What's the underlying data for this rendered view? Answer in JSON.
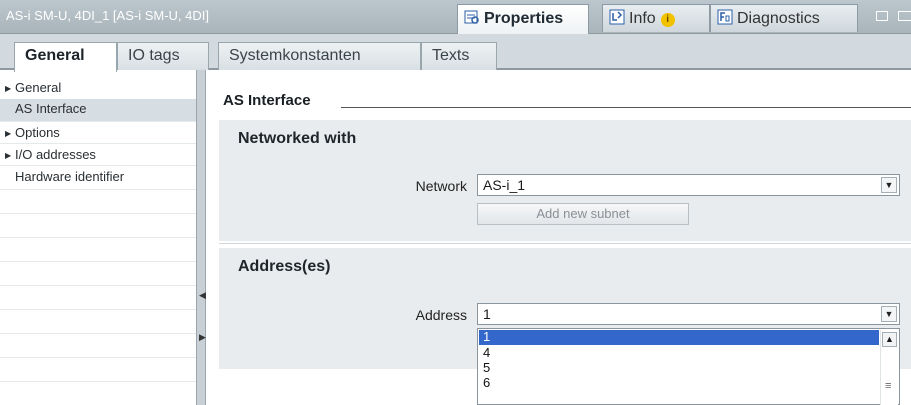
{
  "window": {
    "title": "AS-i SM-U, 4DI_1 [AS-i SM-U, 4DI]"
  },
  "panel_tabs": [
    {
      "label": "Properties",
      "icon": "properties-icon"
    },
    {
      "label": "Info",
      "icon": "info-icon",
      "badge": "i"
    },
    {
      "label": "Diagnostics",
      "icon": "diagnostics-icon"
    }
  ],
  "tabs": [
    {
      "label": "General"
    },
    {
      "label": "IO tags"
    },
    {
      "label": "Systemkonstanten"
    },
    {
      "label": "Texts"
    }
  ],
  "nav": {
    "items": [
      {
        "label": "General",
        "expandable": true
      },
      {
        "label": "AS Interface",
        "selected": true
      },
      {
        "label": "Options",
        "expandable": true
      },
      {
        "label": "I/O addresses",
        "expandable": true
      },
      {
        "label": "Hardware identifier"
      }
    ]
  },
  "main": {
    "section_title": "AS Interface",
    "networked": {
      "heading": "Networked with",
      "network_label": "Network",
      "network_value": "AS-i_1",
      "add_subnet_label": "Add new subnet"
    },
    "addresses": {
      "heading": "Address(es)",
      "address_label": "Address",
      "address_value": "1",
      "options": [
        "1",
        "4",
        "5",
        "6"
      ],
      "selected_option": "1"
    }
  },
  "colors": {
    "selection": "#3367cc",
    "titlebar": "#bcc6cd",
    "group_bg": "#e9ecee"
  }
}
